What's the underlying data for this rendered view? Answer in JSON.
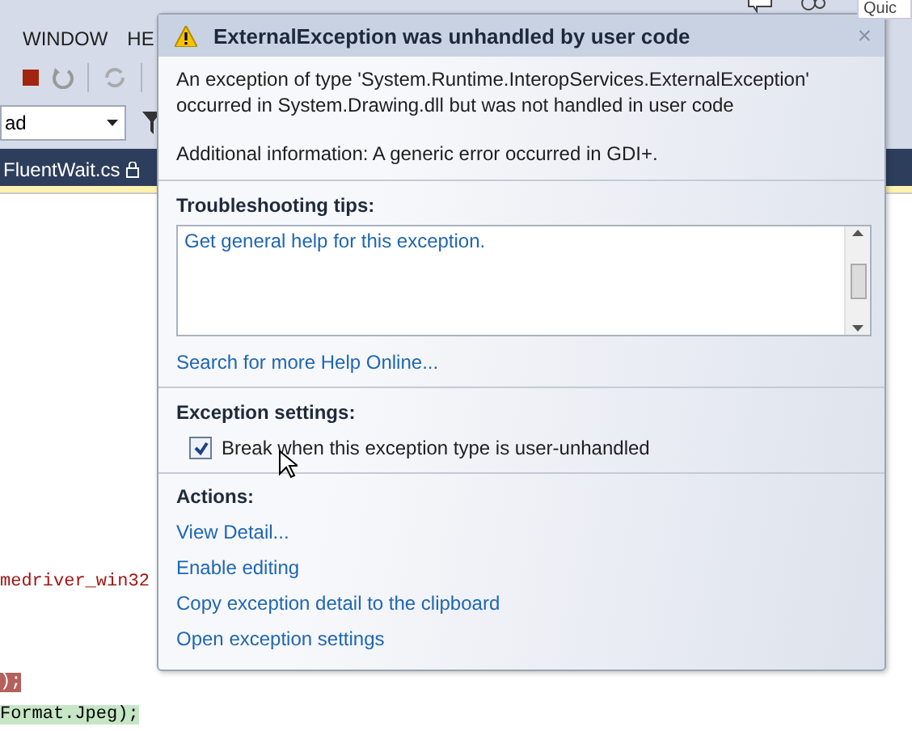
{
  "ide": {
    "menu": [
      "WINDOW",
      "HE"
    ],
    "quick_launch": {
      "placeholder": "Quic"
    },
    "config_dropdown": {
      "value": "ad"
    },
    "tab": {
      "label": "FluentWait.cs"
    },
    "code_lines": [
      {
        "text": "medriver_win32",
        "kind": "plain"
      },
      {
        "text": ");",
        "kind": "error"
      },
      {
        "text": "Format.Jpeg);",
        "kind": "current"
      }
    ]
  },
  "dialog": {
    "title": "ExternalException was unhandled by user code",
    "close": "×",
    "message": "An exception of type 'System.Runtime.InteropServices.ExternalException' occurred in System.Drawing.dll but was not handled in user code",
    "additional": "Additional information: A generic error occurred in GDI+.",
    "troubleshooting": {
      "heading": "Troubleshooting tips:",
      "tips": [
        "Get general help for this exception."
      ],
      "link": "Search for more Help Online..."
    },
    "settings": {
      "heading": "Exception settings:",
      "checkbox": {
        "label": "Break when this exception type is user-unhandled",
        "checked": true
      }
    },
    "actions": {
      "heading": "Actions:",
      "links": [
        "View Detail...",
        "Enable editing",
        "Copy exception detail to the clipboard",
        "Open exception settings"
      ]
    }
  }
}
